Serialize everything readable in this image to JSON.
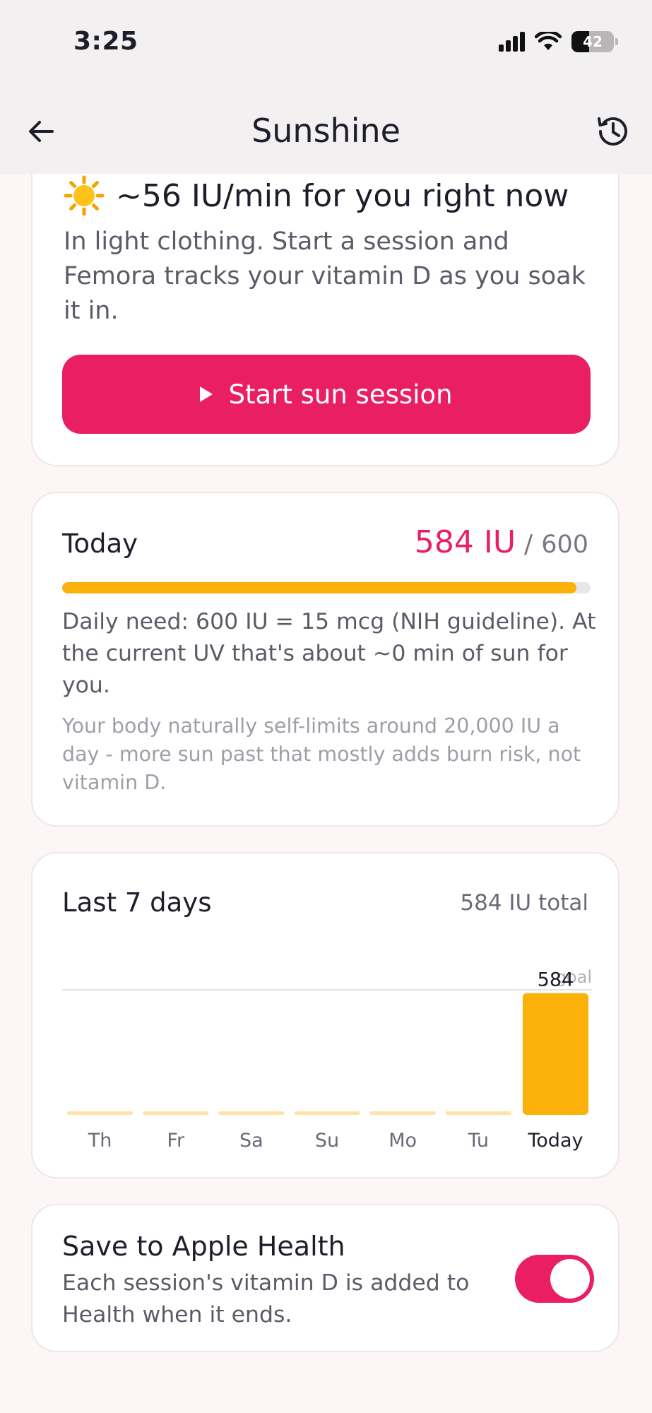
{
  "status_bar": {
    "time": "3:25",
    "battery_level": "42"
  },
  "nav": {
    "title": "Sunshine",
    "back_icon": "arrow-left-icon",
    "history_icon": "history-icon"
  },
  "sun_card": {
    "sun_icon": "sun-emoji-icon",
    "rate": "~56 IU/min for you right now",
    "description": "In light clothing. Start a session and Femora tracks your vitamin D as you soak it in.",
    "button_label": "Start sun session"
  },
  "today_card": {
    "label": "Today",
    "value": "584 IU",
    "separator": "/",
    "goal": "600",
    "progress_fraction": 0.973,
    "need_text": "Daily need: 600 IU = 15 mcg (NIH guideline). At the current UV that's about ~0 min of sun for you.",
    "limit_text": "Your body naturally self-limits around 20,000 IU a day - more sun past that mostly adds burn risk, not vitamin D."
  },
  "week_card": {
    "label": "Last 7 days",
    "total": "584 IU total"
  },
  "chart_data": {
    "type": "bar",
    "categories": [
      "Th",
      "Fr",
      "Sa",
      "Su",
      "Mo",
      "Tu",
      "Today"
    ],
    "values": [
      0,
      0,
      0,
      0,
      0,
      0,
      584
    ],
    "goal": 600,
    "goal_label": "goal",
    "value_labels": [
      "",
      "",
      "",
      "",
      "",
      "",
      "584"
    ],
    "ylim": [
      0,
      600
    ],
    "colors": {
      "bar": "#fbb10a",
      "empty_bar": "#fde3a6",
      "goal_line": "#e6e3e8"
    }
  },
  "health_card": {
    "title": "Save to Apple Health",
    "description": "Each session's vitamin D is added to Health when it ends.",
    "toggle_on": true
  },
  "colors": {
    "accent": "#e91e63",
    "progress": "#fbb10a"
  }
}
